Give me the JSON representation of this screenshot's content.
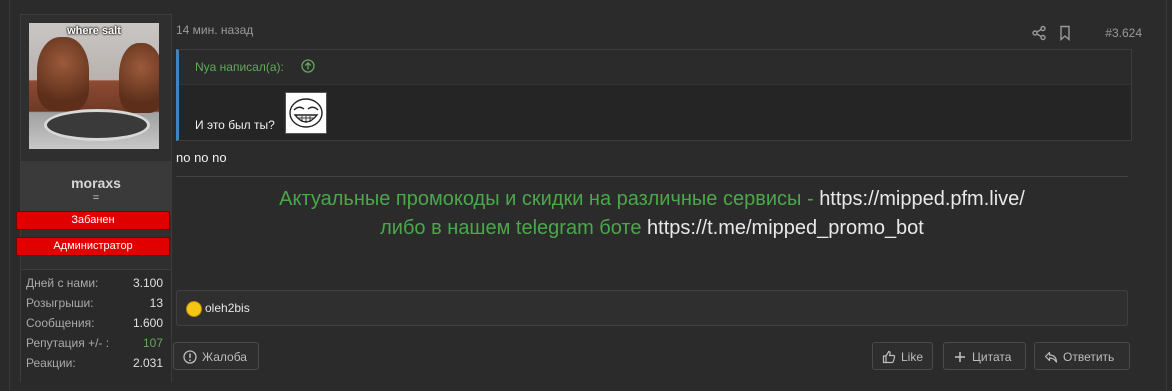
{
  "user": {
    "avatar_caption": "where salt",
    "username": "moraxs",
    "title": "=",
    "banners": [
      "Забанен",
      "Администратор"
    ],
    "stats": [
      {
        "label": "Дней с нами:",
        "value": "3.100"
      },
      {
        "label": "Розыгрыши:",
        "value": "13"
      },
      {
        "label": "Сообщения:",
        "value": "1.600"
      },
      {
        "label": "Репутация +/- :",
        "value": "107"
      },
      {
        "label": "Реакции:",
        "value": "2.031"
      }
    ]
  },
  "post": {
    "time": "14 мин. назад",
    "number": "#3.624",
    "quote": {
      "author_line": "Nya написал(а):",
      "text": "И это был ты?"
    },
    "message": "no no no",
    "signature": {
      "line1_green": "Актуальные промокоды и скидки на различные сервисы - ",
      "line1_link": "https://mipped.pfm.live/",
      "line2_green": "либо в нашем telegram боте ",
      "line2_link": "https://t.me/mipped_promo_bot"
    },
    "reaction_user": "oleh2bis"
  },
  "buttons": {
    "report": "Жалоба",
    "like": "Like",
    "quote": "Цитата",
    "reply": "Ответить"
  },
  "colors": {
    "accent_green": "#62a85a",
    "signature_green": "#4aa84a",
    "quote_border": "#3e86c2",
    "banner_red": "#e10000"
  }
}
